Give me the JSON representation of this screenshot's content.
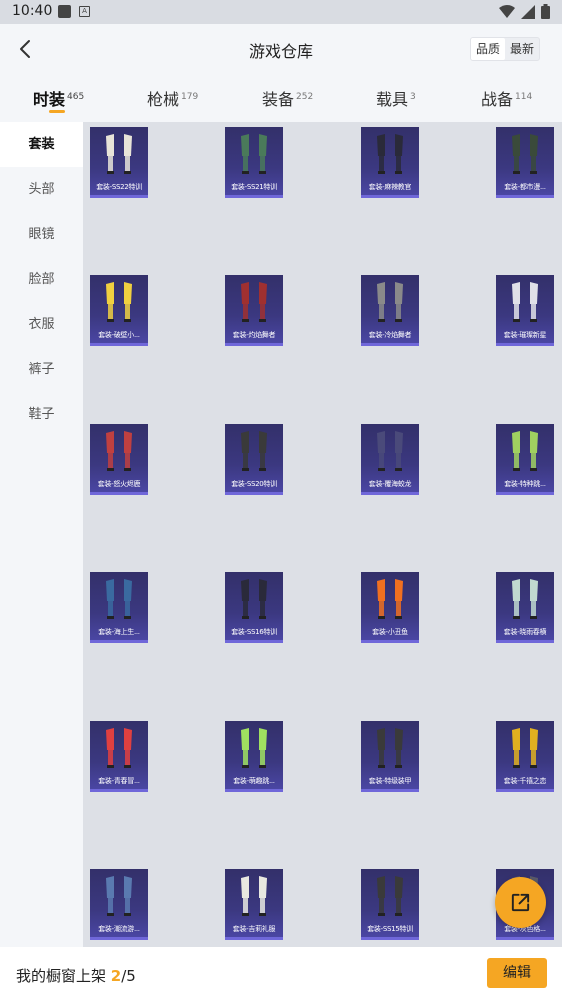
{
  "status_bar": {
    "time": "10:40",
    "box_icon_glyph": "A"
  },
  "header": {
    "title": "游戏仓库",
    "sort_options": [
      "品质",
      "最新"
    ],
    "active_sort": "品质"
  },
  "tabs": [
    {
      "label": "时装",
      "count": "465",
      "active": true
    },
    {
      "label": "枪械",
      "count": "179",
      "active": false
    },
    {
      "label": "装备",
      "count": "252",
      "active": false
    },
    {
      "label": "载具",
      "count": "3",
      "active": false
    },
    {
      "label": "战备",
      "count": "114",
      "active": false
    }
  ],
  "sidebar": [
    {
      "label": "套装",
      "active": true
    },
    {
      "label": "头部",
      "active": false
    },
    {
      "label": "眼镜",
      "active": false
    },
    {
      "label": "脸部",
      "active": false
    },
    {
      "label": "衣服",
      "active": false
    },
    {
      "label": "裤子",
      "active": false
    },
    {
      "label": "鞋子",
      "active": false
    }
  ],
  "items": [
    {
      "label": "套装-SS22特训",
      "color": "#e8e4d8"
    },
    {
      "label": "套装-SS21特训",
      "color": "#4a7a5a"
    },
    {
      "label": "套装-麻辣教官",
      "color": "#2a2a3a"
    },
    {
      "label": "套装-都市漫...",
      "color": "#3a4a3a"
    },
    {
      "label": "套装-破壁小...",
      "color": "#f0d040"
    },
    {
      "label": "套装-灼焰舞者",
      "color": "#a03030"
    },
    {
      "label": "套装-冷焰舞者",
      "color": "#8a8a8a"
    },
    {
      "label": "套装-璀璨新星",
      "color": "#e0e0e8"
    },
    {
      "label": "套装-怒火烬鹿",
      "color": "#c04040"
    },
    {
      "label": "套装-SS20特训",
      "color": "#3a3a3a"
    },
    {
      "label": "套装-覆海蛟龙",
      "color": "#4a4a7a"
    },
    {
      "label": "套装-特种跳...",
      "color": "#a0d060"
    },
    {
      "label": "套装-海上生...",
      "color": "#3a6aa0"
    },
    {
      "label": "套装-SS16特训",
      "color": "#2a2a3a"
    },
    {
      "label": "套装-小丑鱼",
      "color": "#f07020"
    },
    {
      "label": "套装-晓雨春横",
      "color": "#c0d8d0"
    },
    {
      "label": "套装-青春冒...",
      "color": "#e04040"
    },
    {
      "label": "套装-萌趣跳...",
      "color": "#a0e060"
    },
    {
      "label": "套装-特级装甲",
      "color": "#3a3a3a"
    },
    {
      "label": "套装-千禧之恋",
      "color": "#e0b020"
    },
    {
      "label": "套装-潮流游...",
      "color": "#5a7ab0"
    },
    {
      "label": "套装-吉莉礼服",
      "color": "#e8e8e0"
    },
    {
      "label": "套装-SS15特训",
      "color": "#3a3a3a"
    },
    {
      "label": "套装-灰色格...",
      "color": "#5a5a6a"
    }
  ],
  "bottom": {
    "prefix": "我的橱窗上架 ",
    "current": "2",
    "separator": "/",
    "total": "5",
    "edit_label": "编辑"
  },
  "colors": {
    "accent": "#f5a623",
    "card_bg": "#3b3880"
  }
}
